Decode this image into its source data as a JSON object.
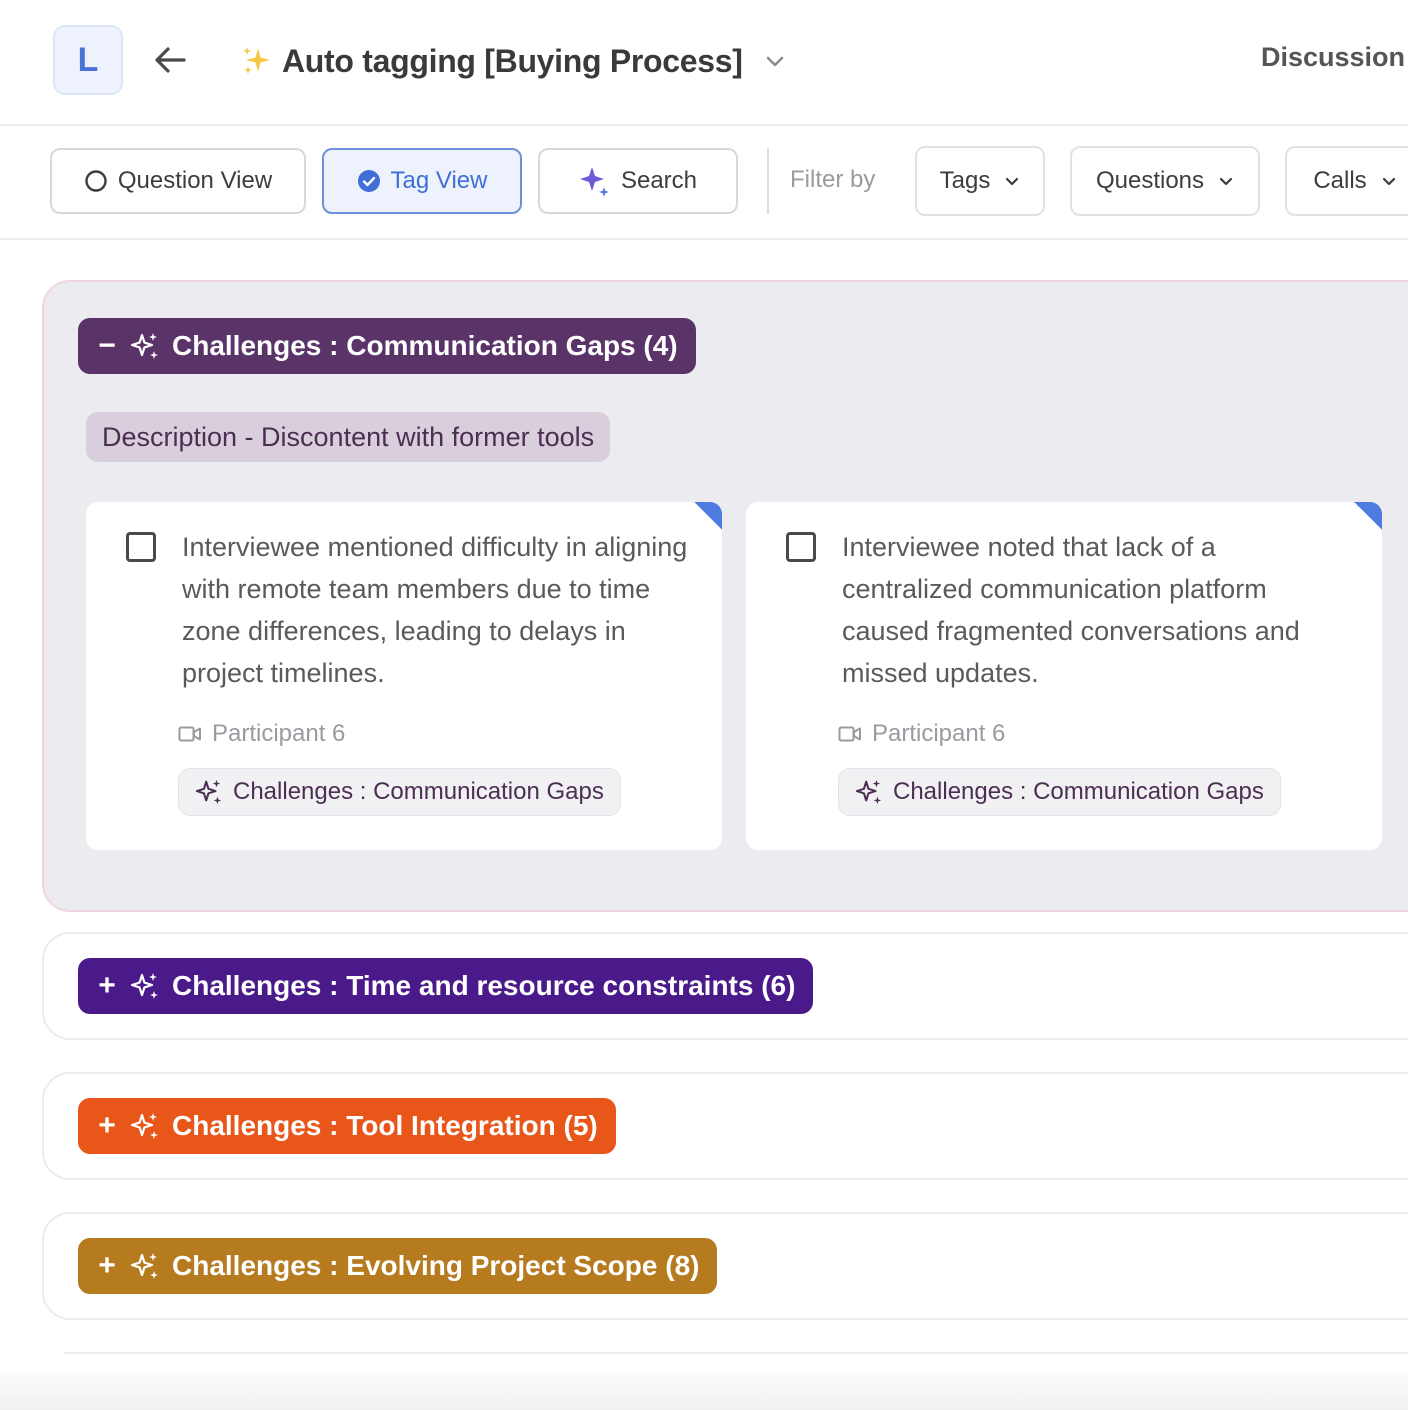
{
  "header": {
    "avatar_letter": "L",
    "title": "Auto tagging [Buying Process]",
    "right_tab": "Discussion"
  },
  "toolbar": {
    "views": [
      {
        "label": "Question View",
        "active": false
      },
      {
        "label": "Tag View",
        "active": true
      },
      {
        "label": "Search",
        "active": false
      }
    ],
    "filter_label": "Filter by",
    "filters": [
      "Tags",
      "Questions",
      "Calls"
    ]
  },
  "groups": [
    {
      "label": "Challenges : Communication Gaps (4)",
      "toggle": "−",
      "color": "#5a3468",
      "expanded": true,
      "description": "Description - Discontent with former tools",
      "cards": [
        {
          "text": "Interviewee mentioned difficulty in aligning with remote team members due to time zone differences, leading to delays in project timelines.",
          "participant": "Participant 6",
          "tag": "Challenges : Communication Gaps"
        },
        {
          "text": "Interviewee noted that lack of a centralized communication platform caused fragmented conversations and missed updates.",
          "participant": "Participant 6",
          "tag": "Challenges : Communication Gaps"
        }
      ]
    },
    {
      "label": "Challenges : Time and resource constraints (6)",
      "toggle": "+",
      "color": "#4b1a8a",
      "expanded": false
    },
    {
      "label": "Challenges : Tool Integration (5)",
      "toggle": "+",
      "color": "#e8561a",
      "expanded": false
    },
    {
      "label": "Challenges : Evolving Project Scope (8)",
      "toggle": "+",
      "color": "#b67a1f",
      "expanded": false
    }
  ],
  "colors": {
    "accent_blue": "#3f6fd6",
    "sparkle_purple": "#6b5bd6",
    "card_corner": "#4d7be0"
  }
}
